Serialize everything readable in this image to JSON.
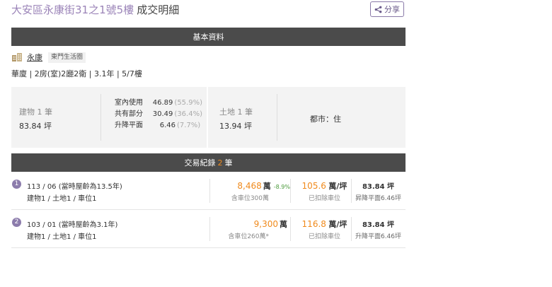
{
  "header": {
    "address": "大安區永康街31之1號5樓",
    "suffix": "成交明細",
    "share_label": "分享"
  },
  "basic": {
    "section_title": "基本資料",
    "community_name": "永康",
    "community_tag": "東門生活圈",
    "summary": "華廈 | 2房(室)2廳2衛 | 3.1年 | 5/7樓",
    "building": {
      "label": "建物 1 筆",
      "area": "83.84 坪",
      "breakdown": [
        {
          "label": "室內使用",
          "value": "46.89",
          "pct": "(55.9%)"
        },
        {
          "label": "共有部分",
          "value": "30.49",
          "pct": "(36.4%)"
        },
        {
          "label": "升降平面",
          "value": "6.46",
          "pct": "(7.7%)"
        }
      ]
    },
    "land": {
      "label": "土地 1 筆",
      "area": "13.94 坪",
      "zone": "都市：住"
    }
  },
  "transactions": {
    "title_prefix": "交易紀錄",
    "count": "2",
    "title_suffix": "筆",
    "items": [
      {
        "index": "1",
        "date": "113 / 06 (當時屋齡為13.5年)",
        "units": "建物1 / 土地1 / 車位1",
        "price": "8,468",
        "price_unit": "萬",
        "change": "-8.9%",
        "price_note": "含車位300萬",
        "unit_price": "105.6",
        "unit_price_unit": "萬/坪",
        "unit_note": "已扣除車位",
        "area": "83.84 坪",
        "area_note": "昇降平面6.46坪"
      },
      {
        "index": "2",
        "date": "103 / 01 (當時屋齡為3.1年)",
        "units": "建物1 / 土地1 / 車位1",
        "price": "9,300",
        "price_unit": "萬",
        "change": "",
        "price_note": "含車位260萬*",
        "unit_price": "116.8",
        "unit_price_unit": "萬/坪",
        "unit_note": "已扣除車位",
        "area": "83.84 坪",
        "area_note": "升降平面6.46坪"
      }
    ]
  },
  "colors": {
    "accent_purple": "#9b84b8",
    "price_orange": "#f08a1c",
    "header_bar": "#4b4b4b",
    "change_green": "#4a9a3a"
  },
  "icons": [
    "share-icon",
    "building-icon"
  ]
}
